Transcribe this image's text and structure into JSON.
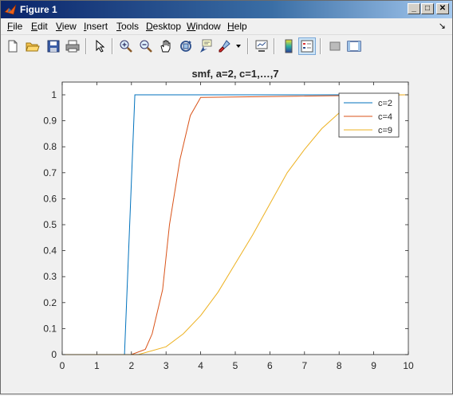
{
  "window": {
    "title": "Figure 1"
  },
  "menu": {
    "items": [
      {
        "label": "File",
        "key": "F",
        "rest": "ile"
      },
      {
        "label": "Edit",
        "key": "E",
        "rest": "dit"
      },
      {
        "label": "View",
        "key": "V",
        "rest": "iew"
      },
      {
        "label": "Insert",
        "key": "I",
        "rest": "nsert"
      },
      {
        "label": "Tools",
        "key": "T",
        "rest": "ools"
      },
      {
        "label": "Desktop",
        "key": "D",
        "rest": "esktop"
      },
      {
        "label": "Window",
        "key": "W",
        "rest": "indow"
      },
      {
        "label": "Help",
        "key": "H",
        "rest": "elp"
      }
    ],
    "dock_arrow": "↘"
  },
  "toolbar": {
    "buttons": [
      {
        "name": "new-figure-icon"
      },
      {
        "name": "open-file-icon"
      },
      {
        "name": "save-icon"
      },
      {
        "name": "print-icon"
      },
      {
        "name": "edit-plot-icon"
      },
      {
        "name": "zoom-in-icon"
      },
      {
        "name": "zoom-out-icon"
      },
      {
        "name": "pan-icon"
      },
      {
        "name": "rotate-3d-icon"
      },
      {
        "name": "data-cursor-icon"
      },
      {
        "name": "brush-icon"
      },
      {
        "name": "link-plot-icon"
      },
      {
        "name": "insert-colorbar-icon"
      },
      {
        "name": "insert-legend-icon"
      },
      {
        "name": "hide-plot-tools-icon"
      },
      {
        "name": "show-plot-tools-icon"
      }
    ]
  },
  "chart_data": {
    "type": "line",
    "title": "smf, a=2, c=1,…,7",
    "xlabel": "",
    "ylabel": "",
    "xlim": [
      0,
      10
    ],
    "ylim": [
      0,
      1.05
    ],
    "xticks": [
      "0",
      "1",
      "2",
      "3",
      "4",
      "5",
      "6",
      "7",
      "8",
      "9",
      "10"
    ],
    "yticks": [
      "0",
      "0.1",
      "0.2",
      "0.3",
      "0.4",
      "0.5",
      "0.6",
      "0.7",
      "0.8",
      "0.9",
      "1"
    ],
    "grid": false,
    "legend_position": "top-right",
    "series": [
      {
        "name": "c=2",
        "color": "#0072bd",
        "x": [
          0,
          1.8,
          2.1,
          10
        ],
        "y": [
          0,
          0,
          1,
          1
        ]
      },
      {
        "name": "c=4",
        "color": "#d95319",
        "x": [
          0,
          2.0,
          2.4,
          2.6,
          2.9,
          3.1,
          3.4,
          3.7,
          4.0,
          10
        ],
        "y": [
          0,
          0,
          0.02,
          0.08,
          0.25,
          0.5,
          0.75,
          0.92,
          0.99,
          1
        ]
      },
      {
        "name": "c=9",
        "color": "#edb120",
        "x": [
          0,
          2.2,
          3,
          3.5,
          4,
          4.5,
          5,
          5.5,
          6,
          6.5,
          7,
          7.5,
          8,
          8.5,
          9,
          9.5,
          10
        ],
        "y": [
          0,
          0,
          0.03,
          0.08,
          0.15,
          0.24,
          0.35,
          0.46,
          0.58,
          0.7,
          0.79,
          0.87,
          0.93,
          0.97,
          0.99,
          1.0,
          1.0
        ]
      }
    ]
  }
}
